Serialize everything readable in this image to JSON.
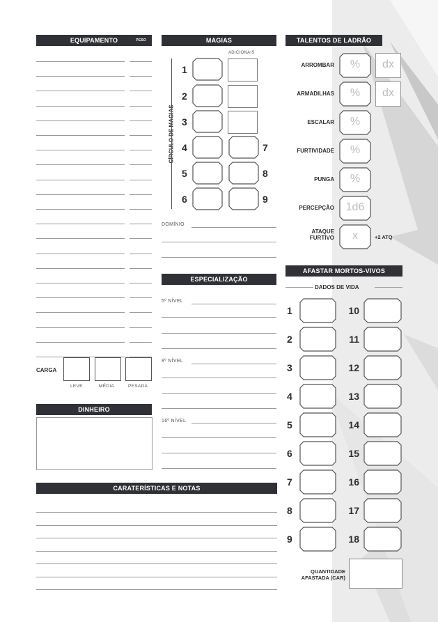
{
  "equipment": {
    "title": "EQUIPAMENTO",
    "weight_label": "PESO",
    "load_label": "CARGA",
    "load_levels": [
      "LEVE",
      "MÉDIA",
      "PESADA"
    ]
  },
  "money": {
    "title": "DINHEIRO"
  },
  "notes": {
    "title": "CARATERÍSTICAS E NOTAS"
  },
  "spells": {
    "title": "MAGIAS",
    "extra_label": "ADICIONAIS",
    "circle_label": "CÍRCULO DE MAGIAS",
    "levels": [
      "1",
      "2",
      "3",
      "4",
      "5",
      "6",
      "7",
      "8",
      "9"
    ],
    "domain_label": "DOMÍNIO"
  },
  "specialization": {
    "title": "ESPECIALIZAÇÃO",
    "levels": [
      "5º NÍVEL",
      "8º NÍVEL",
      "16º NÍVEL"
    ]
  },
  "thief": {
    "title": "TALENTOS DE LADRÃO",
    "skills": [
      {
        "label": "ARROMBAR",
        "value": "%",
        "extra": "dx"
      },
      {
        "label": "ARMADILHAS",
        "value": "%",
        "extra": "dx"
      },
      {
        "label": "ESCALAR",
        "value": "%"
      },
      {
        "label": "FURTIVIDADE",
        "value": "%"
      },
      {
        "label": "PUNGA",
        "value": "%"
      },
      {
        "label": "PERCEPÇÃO",
        "value": "1d6"
      },
      {
        "label": "ATAQUE FURTIVO",
        "value": "x",
        "extra_text": "+2 ATQ"
      }
    ]
  },
  "undead": {
    "title": "AFASTAR MORTOS-VIVOS",
    "hit_dice_label": "DADOS DE VIDA",
    "left": [
      "1",
      "2",
      "3",
      "4",
      "5",
      "6",
      "7",
      "8",
      "9"
    ],
    "right": [
      "10",
      "11",
      "12",
      "13",
      "14",
      "15",
      "16",
      "17",
      "18"
    ],
    "amount_label_1": "QUANTIDADE",
    "amount_label_2": "AFASTADA (CAR)"
  }
}
